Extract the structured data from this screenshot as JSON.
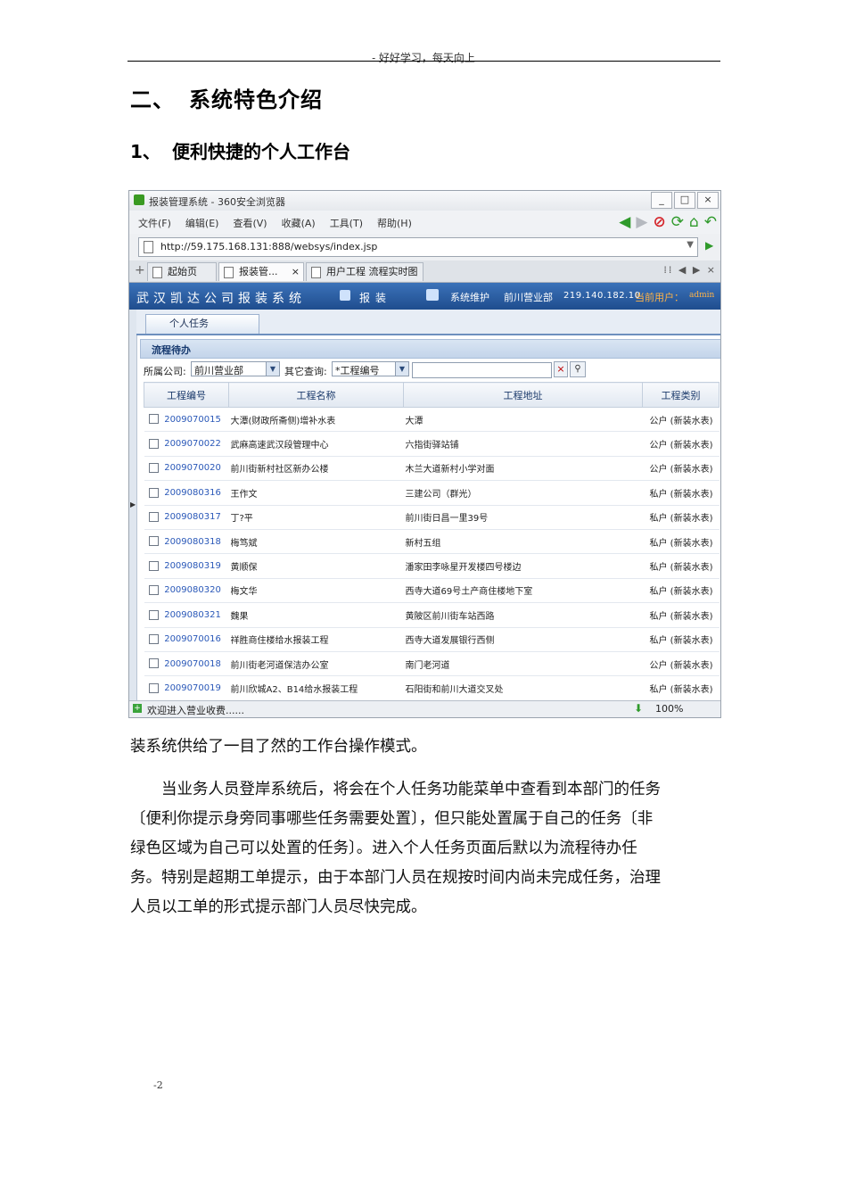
{
  "doc": {
    "header": "- 好好学习，每天向上",
    "h1_num": "二、",
    "h1_text": "系统特色介绍",
    "h2_num": "1、",
    "h2_text": "便利快捷的个人工作台",
    "para_lines": [
      "装系统供给了一目了然的工作台操作模式。",
      "当业务人员登岸系统后，将会在个人任务功能菜单中查看到本部门的任务",
      "〔便利你提示身旁同事哪些任务需要处置〕，但只能处置属于自己的任务〔非",
      "绿色区域为自己可以处置的任务〕。进入个人任务页面后默以为流程待办任",
      "务。特别是超期工单提示，由于本部门人员在规按时间内尚未完成任务，治理",
      "人员以工单的形式提示部门人员尽快完成。"
    ],
    "page_number": "-2"
  },
  "browser": {
    "title": "报装管理系统 - 360安全浏览器",
    "win_buttons": [
      "_",
      "□",
      "×"
    ],
    "menus": [
      "文件(F)",
      "编辑(E)",
      "查看(V)",
      "收藏(A)",
      "工具(T)",
      "帮助(H)"
    ],
    "nav_icons": [
      "back-arrow",
      "forward-arrow",
      "stop",
      "refresh",
      "home",
      "undo"
    ],
    "url": "http://59.175.168.131:888/websys/index.jsp",
    "tabs": [
      "起始页",
      "报装管...",
      "用户工程 流程实时图"
    ],
    "status_text": "欢迎进入营业收费......",
    "zoom": "100%"
  },
  "app": {
    "system_name": "武汉凯达公司报装系统",
    "menu_baozhuang": "报装",
    "menu_sysmaint": "系统维护",
    "dept": "前川营业部",
    "ip": "219.140.182.10",
    "current_user_label": "当前用户：",
    "current_user": "admin",
    "subtab": "个人任务",
    "section": "流程待办",
    "filter": {
      "company_label": "所属公司:",
      "company_value": "前川营业部",
      "other_label": "其它查询:",
      "other_value": "*工程编号",
      "search_value": ""
    },
    "columns": [
      "工程编号",
      "工程名称",
      "工程地址",
      "工程类别"
    ],
    "rows": [
      {
        "id": "2009070015",
        "name": "大潭(财政所斋侧)增补水表",
        "addr": "大潭",
        "type": "公户 (新装水表)"
      },
      {
        "id": "2009070022",
        "name": "武麻高速武汉段管理中心",
        "addr": "六指街驿站铺",
        "type": "公户 (新装水表)"
      },
      {
        "id": "2009070020",
        "name": "前川街新村社区新办公楼",
        "addr": "木兰大道新村小学对面",
        "type": "公户 (新装水表)"
      },
      {
        "id": "2009080316",
        "name": "王作文",
        "addr": "三建公司（群光）",
        "type": "私户 (新装水表)"
      },
      {
        "id": "2009080317",
        "name": "丁?平",
        "addr": "前川街日昌一里39号",
        "type": "私户 (新装水表)"
      },
      {
        "id": "2009080318",
        "name": "梅笃斌",
        "addr": "新村五组",
        "type": "私户 (新装水表)"
      },
      {
        "id": "2009080319",
        "name": "黄顺保",
        "addr": "潘家田李咏星开发楼四号楼边",
        "type": "私户 (新装水表)"
      },
      {
        "id": "2009080320",
        "name": "梅文华",
        "addr": "西寺大道69号土产商住楼地下室",
        "type": "私户 (新装水表)"
      },
      {
        "id": "2009080321",
        "name": "魏果",
        "addr": "黄陂区前川街车站西路",
        "type": "私户 (新装水表)"
      },
      {
        "id": "2009070016",
        "name": "祥胜商住楼给水报装工程",
        "addr": "西寺大道发展银行西侧",
        "type": "私户 (新装水表)"
      },
      {
        "id": "2009070018",
        "name": "前川街老河道保洁办公室",
        "addr": "南门老河道",
        "type": "公户 (新装水表)"
      },
      {
        "id": "2009070019",
        "name": "前川欣城A2、B14给水报装工程",
        "addr": "石阳街和前川大道交叉处",
        "type": "私户 (新装水表)"
      }
    ]
  }
}
